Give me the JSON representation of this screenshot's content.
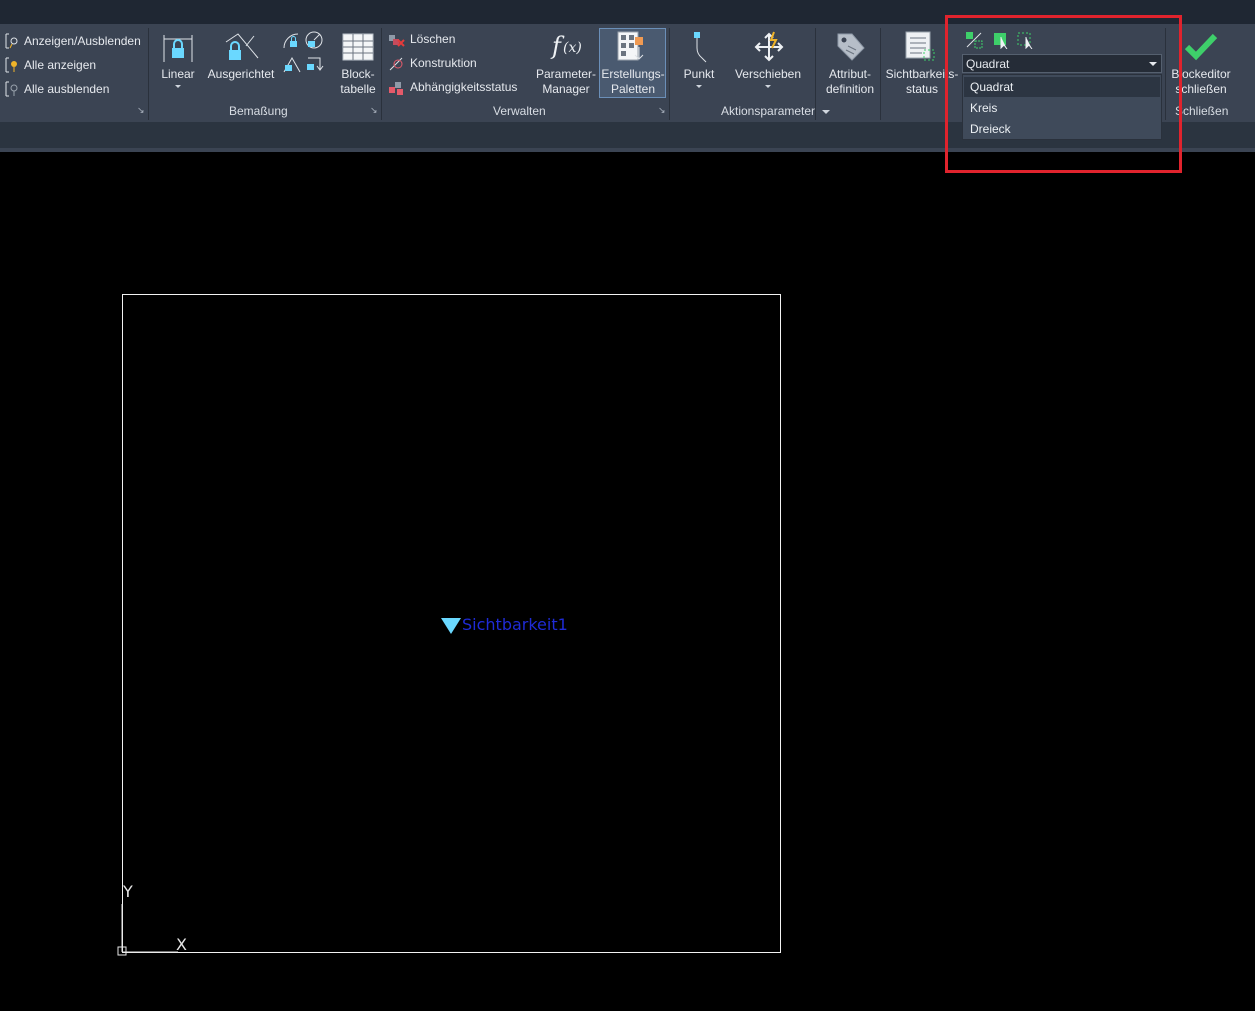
{
  "ribbon": {
    "visibility_group": {
      "show_hide": "Anzeigen/Ausblenden",
      "show_all": "Alle anzeigen",
      "hide_all": "Alle ausblenden"
    },
    "dimension_panel": {
      "linear": "Linear",
      "aligned": "Ausgerichtet",
      "title": "Bemaßung"
    },
    "manage_panel": {
      "table_line1": "Block-",
      "table_line2": "tabelle",
      "delete": "Löschen",
      "construction": "Konstruktion",
      "constraint_status": "Abhängigkeitsstatus",
      "param_manager_line1": "Parameter-",
      "param_manager_line2": "Manager",
      "authoring_line1": "Erstellungs-",
      "authoring_line2": "Paletten",
      "title": "Verwalten"
    },
    "action_panel": {
      "point": "Punkt",
      "move": "Verschieben",
      "title": "Aktionsparameter"
    },
    "attribute": {
      "line1": "Attribut-",
      "line2": "definition"
    },
    "visibility_state": {
      "line1": "Sichtbarkeits-",
      "line2": "status"
    },
    "visibility_dropdown": {
      "selected": "Quadrat",
      "options": [
        "Quadrat",
        "Kreis",
        "Dreieck"
      ]
    },
    "close_panel": {
      "line1": "Blockeditor",
      "line2": "schließen",
      "title": "Schließen"
    }
  },
  "canvas": {
    "visibility_param_label": "Sichtbarkeit1",
    "ucs_x": "X",
    "ucs_y": "Y"
  },
  "colors": {
    "ribbon_bg": "#3b4453",
    "highlight": "#e0232d",
    "param_blue": "#1f2bd6",
    "param_cyan": "#6ad8ff",
    "check_green": "#3ecf6a"
  }
}
